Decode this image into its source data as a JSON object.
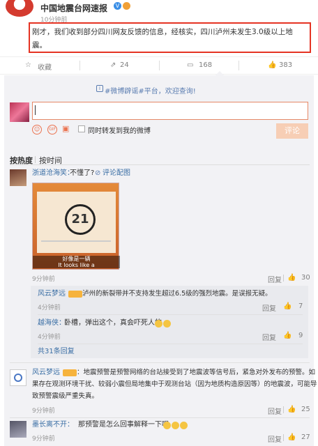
{
  "post": {
    "author": "中国地震台网速报",
    "time": "10分钟前",
    "text_line1": "刚才，我们收到部分四川网友反馈的信息，经核实，四川泸州未发生3.0级以上地",
    "text_line2": "震。"
  },
  "actions": {
    "favorite": "收藏",
    "repost_count": "24",
    "comment_count": "168",
    "like_count": "383"
  },
  "composer": {
    "notice": "#微博辟谣#平台，欢迎查询!",
    "also_repost_label": "同时转发到我的微博",
    "submit_label": "评论"
  },
  "sort": {
    "hot_label": "按热度",
    "time_label": "按时间"
  },
  "comments": [
    {
      "user": "浙道沧海笑：",
      "text": "不懂了?",
      "img_link": "评论配图",
      "time": "9分钟前",
      "reply": "回复",
      "likes": "30",
      "video": {
        "number": "21",
        "caption1": "好像是一辆",
        "caption2": "It looks like a"
      },
      "replies": [
        {
          "user": "风云梦远",
          "text": "泸州的新裂带并不支持发生超过6.5级的强烈地震。是误报无疑。",
          "time": "4分钟前",
          "reply": "回复",
          "likes": "7"
        },
        {
          "user": "越海侠：",
          "text": "卧槽，弹出这个，真会吓死人的",
          "time": "4分钟前",
          "reply": "回复",
          "likes": "9"
        }
      ],
      "more_replies": "共31条回复"
    },
    {
      "user": "风云梦远",
      "text_line1": "：地震预警是预警网络的台站接受到了地震波等信号后，紧急对外发布的预警。如",
      "text_line2": "果存在观测环境干扰、较弱小震但局地集中于观测台站（因为地质构造原因等）的地震波，可能导",
      "text_line3": "致预警震级严重失真。",
      "time": "9分钟前",
      "reply": "回复",
      "likes": "25"
    },
    {
      "user": "墨长离不开：",
      "text": "那预警是怎么回事解释一下呢",
      "time": "9分钟前",
      "reply": "回复",
      "likes": "27"
    }
  ]
}
